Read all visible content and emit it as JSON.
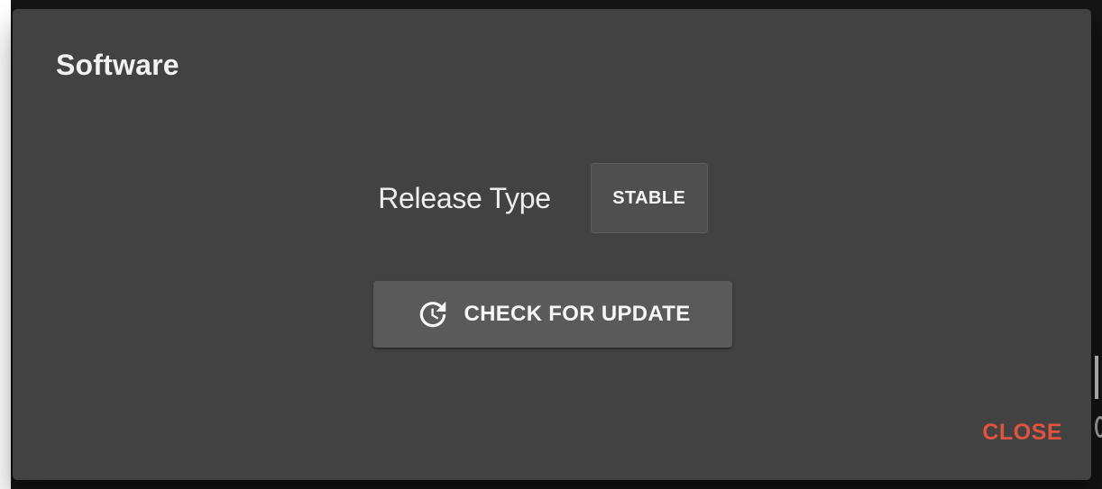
{
  "dialog": {
    "title": "Software",
    "release_type": {
      "label": "Release Type",
      "value": "STABLE"
    },
    "check_update": {
      "label": "CHECK FOR UPDATE",
      "icon": "update-icon"
    },
    "close_label": "CLOSE"
  },
  "colors": {
    "dialog_background": "#424242",
    "backdrop": "#141414",
    "button_background": "#5a5a5a",
    "close_accent": "#e0533f"
  }
}
